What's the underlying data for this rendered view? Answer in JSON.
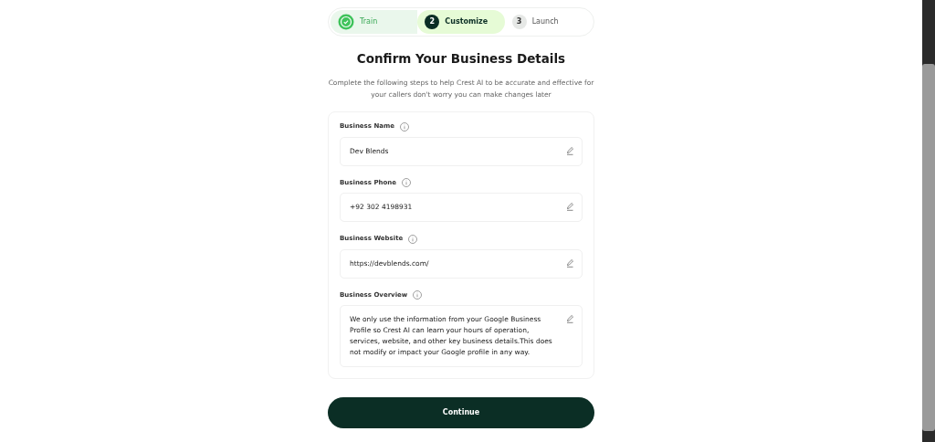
{
  "steps": [
    {
      "label": "Train",
      "kind": "done",
      "selected": false
    },
    {
      "label": "Customize",
      "number": "2",
      "kind": "step",
      "selected": true
    },
    {
      "label": "Launch",
      "number": "3",
      "kind": "step",
      "selected": false
    }
  ],
  "title": "Confirm Your Business Details",
  "subtitle": "Complete the following steps to help Crest AI to be accurate and effective for your callers don't worry you can make changes later",
  "fields": [
    {
      "label": "Business Name",
      "value": "Dev Blends",
      "kind": "line"
    },
    {
      "label": "Business Phone",
      "value": "+92 302 4198931",
      "kind": "line"
    },
    {
      "label": "Business Website",
      "value": "https://devblends.com/",
      "kind": "line"
    },
    {
      "label": "Business Overview",
      "value": "We only use the information from your Google Business Profile so Crest AI can learn your hours of operation, services, website, and other key business details.This does not modify or impact your Google profile in any way.",
      "kind": "area"
    }
  ],
  "continue_button": "Continue"
}
